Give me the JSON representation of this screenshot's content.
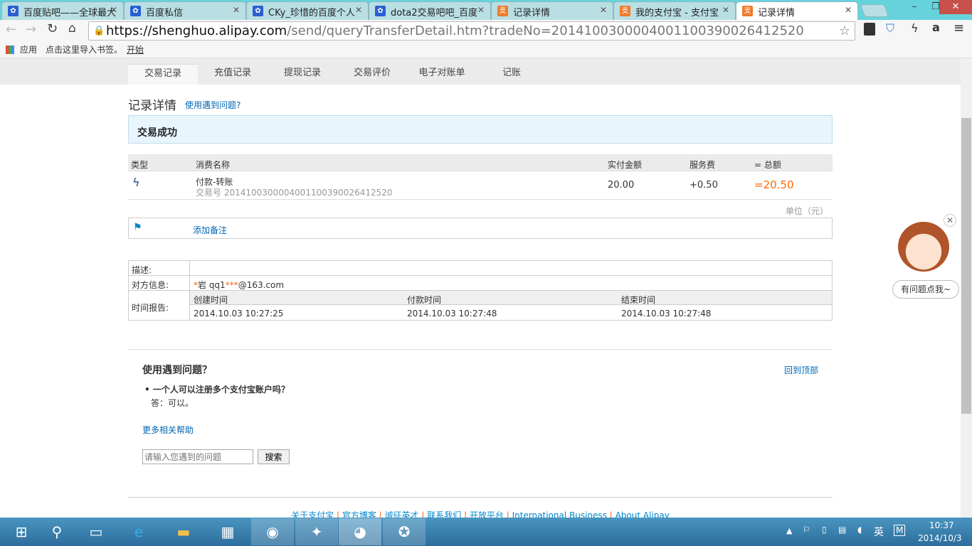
{
  "browser": {
    "tabs": [
      {
        "title": "百度贴吧——全球最大",
        "icon": "baidu-paw-icon"
      },
      {
        "title": "百度私信",
        "icon": "baidu-paw-icon"
      },
      {
        "title": "CKy_珍惜的百度个人",
        "icon": "baidu-paw-icon"
      },
      {
        "title": "dota2交易吧吧_百度",
        "icon": "baidu-paw-icon"
      },
      {
        "title": "记录详情",
        "icon": "alipay-icon"
      },
      {
        "title": "我的支付宝 - 支付宝",
        "icon": "alipay-icon"
      },
      {
        "title": "记录详情",
        "icon": "alipay-icon"
      }
    ],
    "url_host": "https://shenghuo.alipay.com",
    "url_path": "/send/queryTransferDetail.htm?tradeNo=2014100300004001100390026412520",
    "bookmarks": {
      "apps": "应用",
      "import": "点击这里导入书签。",
      "start": "开始"
    }
  },
  "nav": [
    "交易记录",
    "充值记录",
    "提现记录",
    "交易评价",
    "电子对账单",
    "记账"
  ],
  "detail": {
    "title": "记录详情",
    "help_link": "使用遇到问题?",
    "status": "交易成功",
    "headers": [
      "类型",
      "消费名称",
      "实付金额",
      "服务费",
      "= 总额"
    ],
    "row": {
      "name": "付款-转账",
      "trade_label": "交易号",
      "trade_no": "2014100300004001100390026412520",
      "paid": "20.00",
      "fee": "+0.50",
      "total": "=20.50"
    },
    "unit": "单位（元）",
    "add_note": "添加备注",
    "desc_label": "描述:",
    "party_label": "对方信息:",
    "party_star": "*",
    "party_name": "岩 qq1",
    "party_mask": "***",
    "party_email": "@163.com",
    "time_label": "时间报告:",
    "time_headers": [
      "创建时间",
      "付款时间",
      "结束时间"
    ],
    "times": [
      "2014.10.03 10:27:25",
      "2014.10.03 10:27:48",
      "2014.10.03 10:27:48"
    ]
  },
  "help": {
    "title": "使用遇到问题？",
    "back_top": "回到顶部",
    "q": "一个人可以注册多个支付宝账户吗？",
    "a": "答：可以。",
    "more": "更多相关帮助",
    "placeholder": "请输入您遇到的问题",
    "search": "搜索"
  },
  "footer": [
    "关于支付宝",
    "官方博客",
    "诚征英才",
    "联系我们",
    "开放平台",
    "International Business",
    "About Alipay"
  ],
  "widget": {
    "label": "有问题点我~"
  },
  "taskbar": {
    "time": "10:37",
    "date": "2014/10/3",
    "ime": "英"
  },
  "colors": {
    "accent": "#0066b3",
    "total": "#ff6600",
    "status_bg": "#e8f5fd"
  }
}
